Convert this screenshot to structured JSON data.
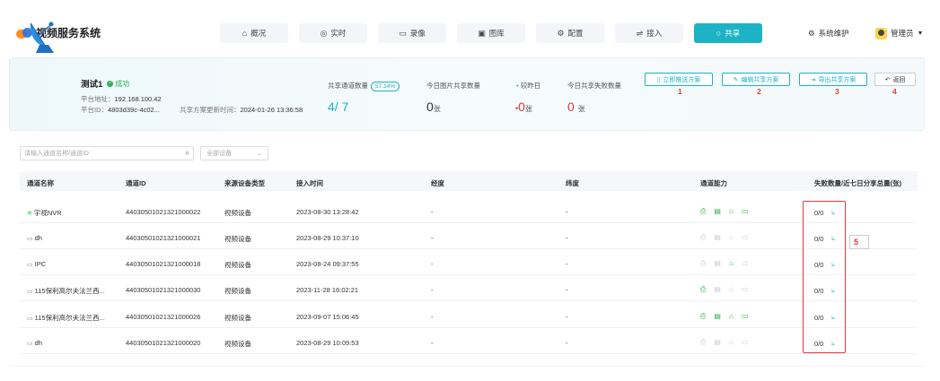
{
  "app": {
    "title": "视频服务系统"
  },
  "nav": [
    {
      "label": "概况",
      "icon": "home-icon"
    },
    {
      "label": "实时",
      "icon": "location-icon"
    },
    {
      "label": "录像",
      "icon": "video-icon"
    },
    {
      "label": "图库",
      "icon": "image-icon"
    },
    {
      "label": "配置",
      "icon": "settings-icon"
    },
    {
      "label": "接入",
      "icon": "plug-icon"
    },
    {
      "label": "共享",
      "icon": "share-icon",
      "active": true
    }
  ],
  "header_right": {
    "system": "系统维护",
    "user": "管理员"
  },
  "platform": {
    "name": "测试1",
    "status": "成功",
    "address_label": "平台地址：",
    "address": "192.168.100.42",
    "id_label": "平台ID：",
    "id": "4803d39c-4c02...",
    "update_label": "共享方案更新时间：",
    "update_time": "2024-01-26 13:36:58"
  },
  "stats": {
    "channels_label": "共享通道数量",
    "channels_pct": "57.14%",
    "channels_shared": "4",
    "channels_total": "/ 7",
    "today_label": "今日图片共享数量",
    "today_value": "0",
    "unit": "张",
    "yesterday_label": "较昨日",
    "yesterday_value": "0",
    "fail_label": "今日共享失败数量",
    "fail_value": "0"
  },
  "actions": {
    "push": "立即推送方案",
    "edit": "编辑共享方案",
    "export": "导出共享方案",
    "back": "返回",
    "numbers": [
      "1",
      "2",
      "3",
      "4"
    ]
  },
  "filters": {
    "search_placeholder": "请输入通道名称/通道ID",
    "device_select": "全部设备"
  },
  "table": {
    "headers": [
      "通道名称",
      "通道ID",
      "来源设备类型",
      "接入时间",
      "经度",
      "纬度",
      "通道能力",
      "失败数量/近七日分享总量(张)"
    ],
    "rows": [
      {
        "name": "宇视NVR",
        "icon": "nvr-icon",
        "id": "44030501021321000022",
        "type": "视频设备",
        "time": "2023-08-30 13:28:42",
        "lng": "-",
        "lat": "-",
        "caps": [
          true,
          true,
          true,
          true
        ],
        "count": "0/0"
      },
      {
        "name": "dh",
        "icon": "camera-icon",
        "id": "44030501021321000021",
        "type": "视频设备",
        "time": "2023-08-29 10:37:10",
        "lng": "-",
        "lat": "-",
        "caps": [
          false,
          false,
          false,
          false
        ],
        "count": "0/0"
      },
      {
        "name": "IPC",
        "icon": "camera-icon",
        "id": "44030501021321000018",
        "type": "视频设备",
        "time": "2023-08-24 09:37:55",
        "lng": "-",
        "lat": "-",
        "caps": [
          false,
          false,
          true,
          false
        ],
        "count": "0/0"
      },
      {
        "name": "115保利高尔夫法兰西...",
        "icon": "camera-icon",
        "id": "44030501021321000030",
        "type": "视频设备",
        "time": "2023-11-28 16:02:21",
        "lng": "-",
        "lat": "-",
        "caps": [
          true,
          false,
          false,
          false
        ],
        "count": "0/0"
      },
      {
        "name": "115保利高尔夫法兰西...",
        "icon": "camera-icon",
        "id": "44030501021321000026",
        "type": "视频设备",
        "time": "2023-09-07 15:06:45",
        "lng": "-",
        "lat": "-",
        "caps": [
          true,
          true,
          true,
          true
        ],
        "count": "0/0"
      },
      {
        "name": "dh",
        "icon": "camera-icon",
        "id": "44030501021321000020",
        "type": "视频设备",
        "time": "2023-08-29 10:09:53",
        "lng": "-",
        "lat": "-",
        "caps": [
          false,
          false,
          false,
          false
        ],
        "count": "0/0"
      }
    ]
  },
  "annotation": {
    "label": "5"
  },
  "colors": {
    "accent": "#1db3c4",
    "success": "#2bb24c",
    "annotation": "#e53935"
  }
}
